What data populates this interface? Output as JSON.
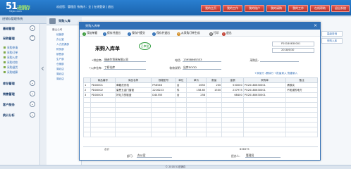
{
  "header": {
    "logo_main": "51",
    "logo_rest": "进销存",
    "logo_sub": "51jxc.com",
    "welcome": "欢迎您：管理员  系统内：全  | 在线登录 | 退出",
    "nav": [
      "我的主页",
      "我的工作",
      "我的账户",
      "我的请购",
      "我的工作",
      "在线帮助",
      "退出系统"
    ]
  },
  "menu_title": "进销存管理系统",
  "sidebar": {
    "sections": [
      {
        "label": "基础管理",
        "icon": "chevron-down-icon"
      },
      {
        "label": "采购管理",
        "icon": "chevron-up-icon"
      },
      {
        "label": "库存管理",
        "icon": "chevron-down-icon"
      },
      {
        "label": "销售管理",
        "icon": "chevron-down-icon"
      },
      {
        "label": "客户服务",
        "icon": "chevron-down-icon"
      },
      {
        "label": "统计分析",
        "icon": "chevron-down-icon"
      }
    ],
    "purchase_items": [
      "采购申请",
      "采购订单",
      "采购入库",
      "采购付款",
      "采购退货",
      "采购结算"
    ]
  },
  "col2": {
    "title": "采购入库",
    "tree": [
      "鹿山公司",
      "经营部",
      "办公室",
      "人力资源部",
      "财务部",
      "销售部",
      "生产部",
      "仓储部",
      "湖北店",
      "湖北店",
      "湖北店"
    ]
  },
  "modal": {
    "title": "采购入库单",
    "toolbar": [
      "添加单据",
      "保存并退出",
      "保存并提交",
      "保存并退出",
      "从采购订单生成",
      "打印",
      "退出"
    ],
    "doc_title": "采购入库单",
    "stamp": "已审批",
    "doc_no": "P20180630001",
    "doc_date": "2018/6/30",
    "fields": {
      "supplier_label": "*供应商:",
      "supplier_value": "瑞迪尔贸易有限公司",
      "phone_label": "电话:",
      "phone_value": "13958665333",
      "purchaser_label": "采购员:",
      "purchaser_value": "",
      "warehouse_label": "*入库仓库:",
      "warehouse_value": "丁桥仓库",
      "contact_label": "收款说明:",
      "contact_value": "出库SOOD"
    },
    "links": "+添加行  -删除行  +批量录入  快捷录入",
    "table": {
      "headers": [
        "",
        "商品编号",
        "商品名称",
        "规格型号",
        "单位",
        "单价",
        "数量",
        "金额",
        "采购单",
        "备注"
      ],
      "rows": [
        [
          "1",
          "PD00001",
          "邮箱洗衣机",
          "FR6546",
          "台",
          "2650",
          "200",
          "530000",
          "PO20180630001",
          "请核实"
        ],
        [
          "2",
          "PD00002",
          "豪恩五金门窗锁",
          "2216223",
          "件",
          "158.65",
          "1500",
          "237975",
          "PO20180630001",
          "不知道的地方"
        ],
        [
          "3",
          "PD00003",
          "好坛力的链盒",
          "D44555",
          "台",
          "258",
          "",
          "68400",
          "PO20180630001",
          ""
        ]
      ]
    },
    "total_label": "合计",
    "total_value": "836375",
    "dept_label": "部门:",
    "dept_value": "办公室",
    "handler_label": "经办人:",
    "handler_value": "管理员"
  },
  "right_panel": {
    "btn1": "高级查询",
    "btn2": "采购入库",
    "link": "查看"
  },
  "status": "© 2018 51进销存"
}
